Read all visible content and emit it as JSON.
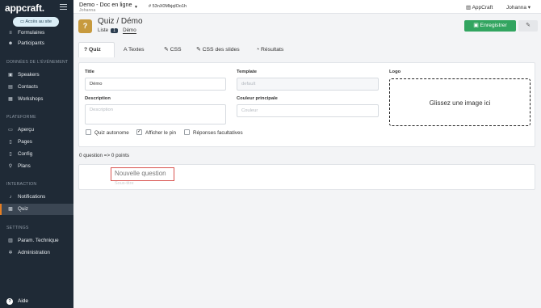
{
  "app": {
    "logo": "appcraft."
  },
  "sidebar": {
    "site_button": "Accès au site",
    "top_items": [
      {
        "label": "Formulaires",
        "icon": "list-icon"
      },
      {
        "label": "Participants",
        "icon": "users-icon"
      }
    ],
    "sections": [
      {
        "title": "DONNÉES DE L'ÉVÉNEMENT",
        "items": [
          {
            "label": "Speakers",
            "icon": "microphone-icon"
          },
          {
            "label": "Contacts",
            "icon": "address-book-icon"
          },
          {
            "label": "Workshops",
            "icon": "calendar-icon"
          }
        ]
      },
      {
        "title": "PLATEFORME",
        "items": [
          {
            "label": "Aperçu",
            "icon": "monitor-icon"
          },
          {
            "label": "Pages",
            "icon": "file-icon"
          },
          {
            "label": "Config",
            "icon": "mobile-icon"
          },
          {
            "label": "Plans",
            "icon": "map-pin-icon"
          }
        ]
      },
      {
        "title": "INTERACTION",
        "items": [
          {
            "label": "Notifications",
            "icon": "bell-icon"
          },
          {
            "label": "Quiz",
            "icon": "quiz-icon"
          }
        ]
      },
      {
        "title": "SETTINGS",
        "items": [
          {
            "label": "Param. Technique",
            "icon": "sliders-icon"
          },
          {
            "label": "Administration",
            "icon": "gear-icon"
          }
        ]
      }
    ],
    "help": "Aide"
  },
  "topbar": {
    "project_name": "Demo - Doc en ligne",
    "project_user": "Johanna",
    "token": "# 53nX0MbjqlOo1h",
    "app_link": "AppCraft",
    "user": "Johanna"
  },
  "header": {
    "title": "Quiz / Démo",
    "list_label": "Liste",
    "list_count": "1",
    "current": "Démo",
    "save_label": "Enregistrer"
  },
  "tabs": [
    {
      "label": "Quiz",
      "icon": "?"
    },
    {
      "label": "Textes",
      "icon": "A"
    },
    {
      "label": "CSS",
      "icon": "✎"
    },
    {
      "label": "CSS des slides",
      "icon": "✎"
    },
    {
      "label": "Résultats",
      "icon": "◔"
    }
  ],
  "form": {
    "title_label": "Title",
    "title_value": "Démo",
    "template_label": "Template",
    "template_placeholder": "default",
    "logo_label": "Logo",
    "logo_drop": "Glissez une image ici",
    "description_label": "Description",
    "description_placeholder": "Description",
    "color_label": "Couleur principale",
    "color_placeholder": "Couleur",
    "checkboxes": [
      {
        "label": "Quiz autonome",
        "checked": false
      },
      {
        "label": "Afficher le pin",
        "checked": true
      },
      {
        "label": "Réponses facultatives",
        "checked": false
      }
    ]
  },
  "summary": "0 question => 0 points",
  "question": {
    "title_placeholder": "Nouvelle question",
    "subtitle_placeholder": "Sous-titre"
  }
}
